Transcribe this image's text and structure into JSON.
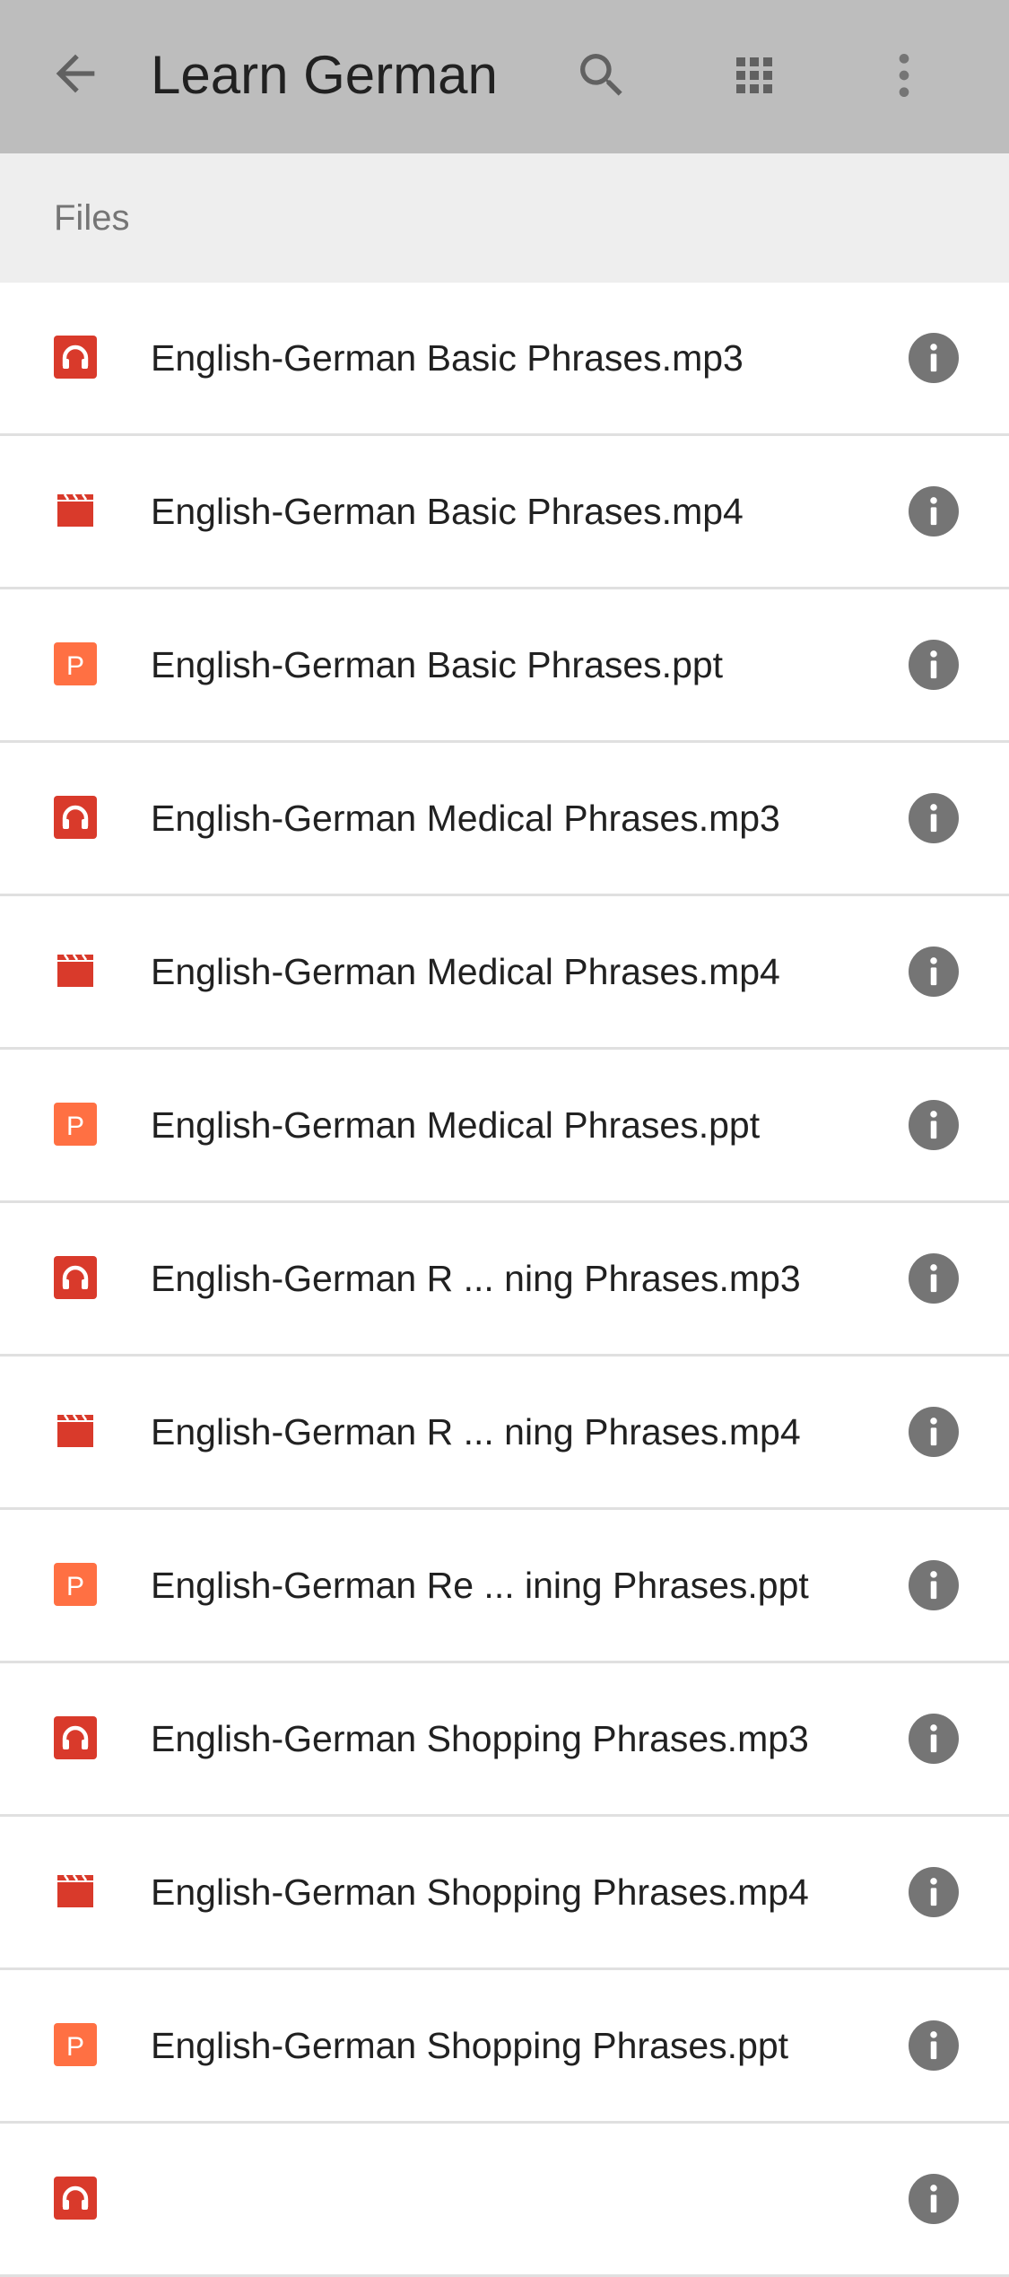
{
  "app": {
    "title": "Learn German"
  },
  "toolbar": {
    "back_icon": "arrow-back-icon",
    "search_icon": "search-icon",
    "grid_icon": "grid-view-icon",
    "more_icon": "more-vert-icon",
    "color": "#bdbdbd"
  },
  "section": {
    "label": "Files"
  },
  "colors": {
    "audio": "#d93a2b",
    "video": "#d93a2b",
    "ppt": "#ff7043",
    "info": "#757575"
  },
  "files": [
    {
      "name": "English-German Basic Phrases.mp3",
      "type": "audio"
    },
    {
      "name": "English-German Basic Phrases.mp4",
      "type": "video"
    },
    {
      "name": "English-German Basic Phrases.ppt",
      "type": "ppt"
    },
    {
      "name": "English-German Medical Phrases.mp3",
      "type": "audio"
    },
    {
      "name": "English-German Medical Phrases.mp4",
      "type": "video"
    },
    {
      "name": "English-German Medical Phrases.ppt",
      "type": "ppt"
    },
    {
      "name": "English-German R ... ning Phrases.mp3",
      "type": "audio"
    },
    {
      "name": "English-German R ... ning Phrases.mp4",
      "type": "video"
    },
    {
      "name": "English-German Re ... ining Phrases.ppt",
      "type": "ppt"
    },
    {
      "name": "English-German Shopping Phrases.mp3",
      "type": "audio"
    },
    {
      "name": "English-German Shopping Phrases.mp4",
      "type": "video"
    },
    {
      "name": "English-German Shopping Phrases.ppt",
      "type": "ppt"
    },
    {
      "name": "",
      "type": "audio"
    }
  ]
}
